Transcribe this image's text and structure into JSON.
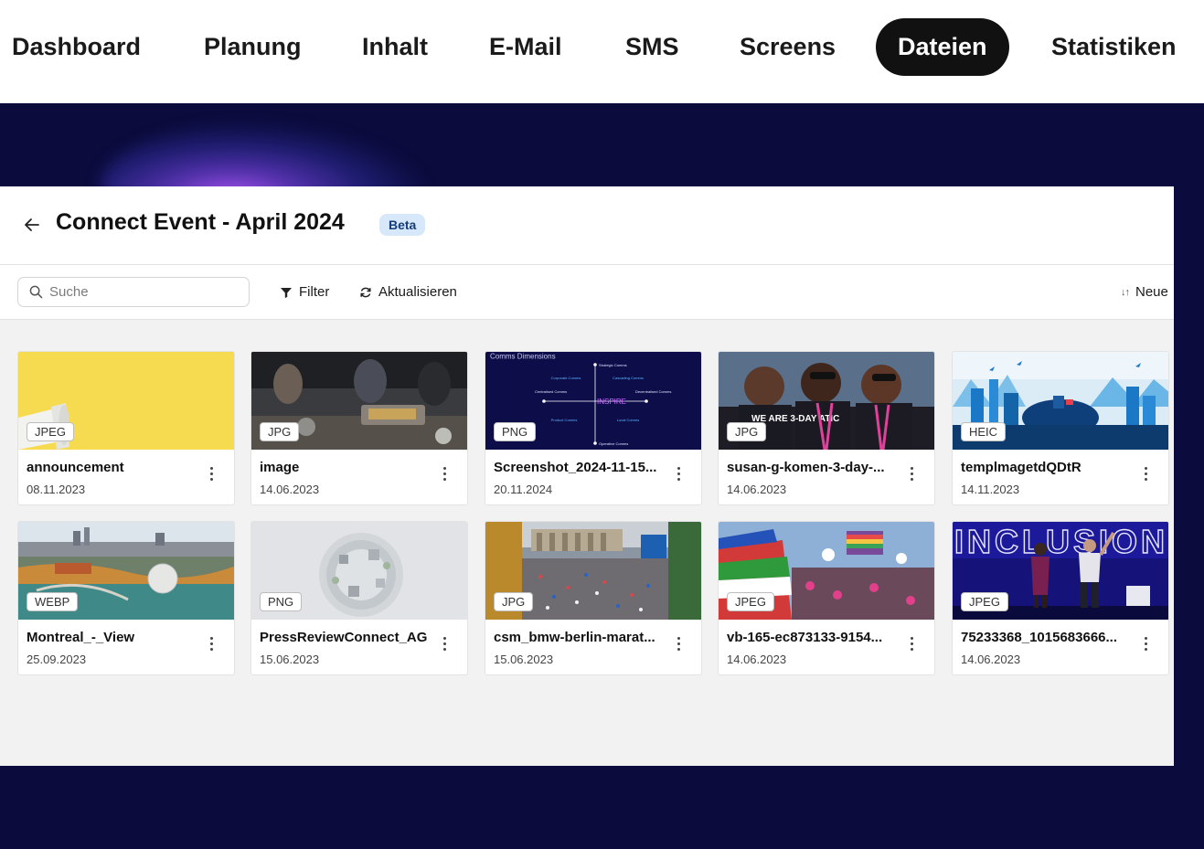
{
  "nav": {
    "items": [
      "Dashboard",
      "Planung",
      "Inhalt",
      "E-Mail",
      "SMS",
      "Screens",
      "Dateien",
      "Statistiken"
    ],
    "active": "Dateien"
  },
  "page": {
    "back_icon": "arrow-left-icon",
    "title": "Connect Event - April 2024",
    "badge": "Beta"
  },
  "toolbar": {
    "search_placeholder": "Suche",
    "search_icon": "search-icon",
    "filter_label": "Filter",
    "filter_icon": "funnel-icon",
    "refresh_label": "Aktualisieren",
    "refresh_icon": "refresh-icon",
    "sort_label": "Neue",
    "sort_icon": "sort-arrows-icon"
  },
  "files": [
    {
      "name": "announcement",
      "date": "08.11.2023",
      "format": "JPEG"
    },
    {
      "name": "image",
      "date": "14.06.2023",
      "format": "JPG"
    },
    {
      "name": "Screenshot_2024-11-15...",
      "date": "20.11.2024",
      "format": "PNG"
    },
    {
      "name": "susan-g-komen-3-day-...",
      "date": "14.06.2023",
      "format": "JPG"
    },
    {
      "name": "templmagetdQDtR",
      "date": "14.11.2023",
      "format": "HEIC"
    },
    {
      "name": "Montreal_-_View",
      "date": "25.09.2023",
      "format": "WEBP"
    },
    {
      "name": "PressReviewConnect_AG",
      "date": "15.06.2023",
      "format": "PNG"
    },
    {
      "name": "csm_bmw-berlin-marat...",
      "date": "15.06.2023",
      "format": "JPG"
    },
    {
      "name": "vb-165-ec873133-9154...",
      "date": "14.06.2023",
      "format": "JPEG"
    },
    {
      "name": "75233368_1015683666...",
      "date": "14.06.2023",
      "format": "JPEG"
    }
  ],
  "thumb_texts": {
    "diagram_title": "Comms Dimensions",
    "diagram_center": "INSPIRE",
    "diagram_top": "Strategic Comms",
    "diagram_bottom": "Operative Comms",
    "diagram_left": "Centralised Comms",
    "diagram_right": "Decentralised Comms",
    "diagram_q1": "Corporate Comms",
    "diagram_q2": "Cascading Comms",
    "diagram_q3": "Product Comms",
    "diagram_q4": "Local Comms",
    "shirt_text": "WE ARE 3-DAY ATIC",
    "banner_text": "INCLUSION"
  },
  "colors": {
    "brand_dark": "#0b0b3d",
    "active_tab": "#111111",
    "badge_bg": "#d7e8fb",
    "badge_fg": "#163d7a"
  }
}
